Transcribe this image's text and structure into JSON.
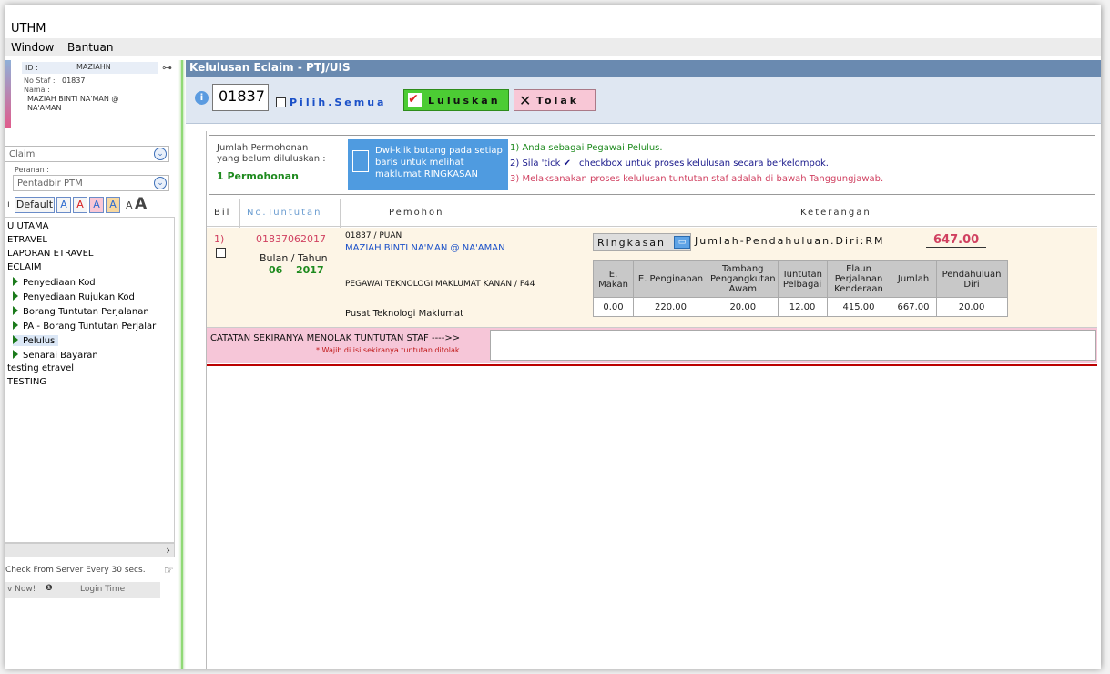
{
  "window": {
    "title": "UTHM"
  },
  "menubar": {
    "items": [
      "Window",
      "Bantuan"
    ]
  },
  "sidebar": {
    "profile": {
      "id_label": "ID :",
      "id_value": "MAZIAHN",
      "staff_label": "No Staf :",
      "staff_value": "01837",
      "name_label": "Nama :",
      "name_line1": "MAZIAH BINTI NA'MAN @",
      "name_line2": "NA'AMAN"
    },
    "system_select": "Claim",
    "role_label": "Peranan :",
    "role_select": "Pentadbir PTM",
    "font_buttons": {
      "default": "Default",
      "a1": "A",
      "a2": "A",
      "a3": "A",
      "a4": "A",
      "a5": "A",
      "a6": "A"
    },
    "tree": [
      "U UTAMA",
      "ETRAVEL",
      "LAPORAN ETRAVEL",
      "ECLAIM",
      "Penyediaan Kod",
      "Penyediaan Rujukan Kod",
      "Borang Tuntutan Perjalanan",
      "PA - Borang Tuntutan Perjalar",
      "Pelulus",
      "Senarai Bayaran",
      "testing etravel",
      "TESTING"
    ],
    "server_check": "Check From Server Every 30 secs.",
    "now_label": "v Now!",
    "login_time_label": "Login Time"
  },
  "main": {
    "header": "Kelulusan Eclaim - PTJ/UIS",
    "toolbar": {
      "staff_input": "01837",
      "select_all": "Pilih.Semua",
      "approve": "Luluskan",
      "reject": "Tolak"
    },
    "info": {
      "pending_line1": "Jumlah Permohonan",
      "pending_line2": "yang belum diluluskan :",
      "pending_value": "1 Permohonan",
      "hint": "Dwi-klik butang pada setiap baris untuk melihat maklumat RINGKASAN",
      "note1": "1) Anda sebagai Pegawai Pelulus.",
      "note2": "2) Sila 'tick ✔ ' checkbox untuk proses kelulusan secara berkelompok.",
      "note3": "3) Melaksanakan proses kelulusan tuntutan staf adalah di bawah Tanggungjawab."
    },
    "grid": {
      "headers": {
        "bil": "Bil",
        "no": "No.Tuntutan",
        "pemohon": "Pemohon",
        "keterangan": "Keterangan"
      },
      "row": {
        "bil": "1)",
        "claim_no": "01837062017",
        "period_label": "Bulan / Tahun",
        "month": "06",
        "year": "2017",
        "staff_title": "01837 / PUAN",
        "name": "MAZIAH BINTI NA'MAN @ NA'AMAN",
        "position": "PEGAWAI TEKNOLOGI MAKLUMAT KANAN / F44",
        "dept": "Pusat Teknologi Maklumat",
        "summary_button": "Ringkasan",
        "total_label": "Jumlah-Pendahuluan.Diri:RM",
        "total_value": "647.00",
        "columns": [
          "E. Makan",
          "E. Penginapan",
          "Tambang Pengangkutan Awam",
          "Tuntutan Pelbagai",
          "Elaun Perjalanan Kenderaan",
          "Jumlah",
          "Pendahuluan Diri"
        ],
        "values": [
          "0.00",
          "220.00",
          "20.00",
          "12.00",
          "415.00",
          "667.00",
          "20.00"
        ]
      }
    },
    "reject_note": {
      "label": "CATATAN SEKIRANYA MENOLAK TUNTUTAN STAF ---->>",
      "sub": "* Wajib di isi sekiranya tuntutan ditolak",
      "value": ""
    }
  }
}
